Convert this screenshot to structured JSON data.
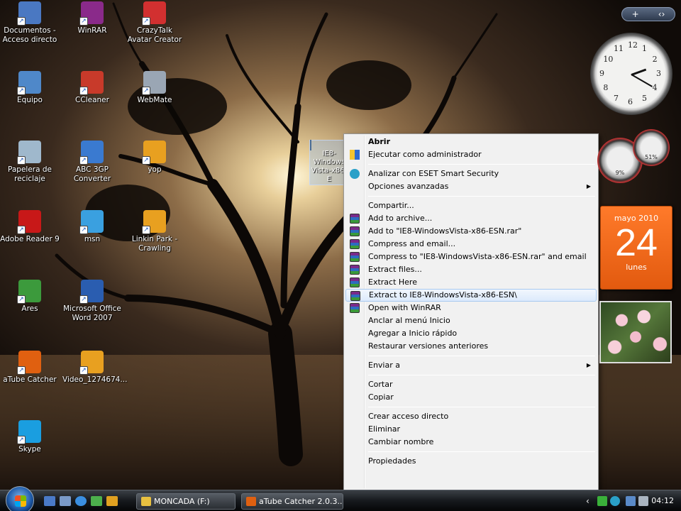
{
  "desktop_icons": [
    {
      "label": "Documentos - Acceso directo",
      "icon": "folder-shortcut-icon",
      "color": "#4a78c2"
    },
    {
      "label": "WinRAR",
      "icon": "winrar-icon",
      "color": "#8a2a8a"
    },
    {
      "label": "CrazyTalk Avatar Creator",
      "icon": "crazytalk-icon",
      "color": "#d23030"
    },
    {
      "label": "Equipo",
      "icon": "computer-icon",
      "color": "#4f88c9"
    },
    {
      "label": "CCleaner",
      "icon": "ccleaner-icon",
      "color": "#c83a2a"
    },
    {
      "label": "WebMate",
      "icon": "webmate-icon",
      "color": "#9aa6b4"
    },
    {
      "label": "Papelera de reciclaje",
      "icon": "recycle-bin-icon",
      "color": "#9fb8cc"
    },
    {
      "label": "ABC 3GP Converter",
      "icon": "abc-3gp-converter-icon",
      "color": "#3a7ad0"
    },
    {
      "label": "yop",
      "icon": "video-file-icon",
      "color": "#e8a020"
    },
    {
      "label": "Adobe Reader 9",
      "icon": "adobe-reader-icon",
      "color": "#c81818"
    },
    {
      "label": "msn",
      "icon": "msn-icon",
      "color": "#3aa0e0"
    },
    {
      "label": "Linkin Park - Crawling",
      "icon": "video-file-icon",
      "color": "#e8a020"
    },
    {
      "label": "Ares",
      "icon": "ares-icon",
      "color": "#3c9a3c"
    },
    {
      "label": "Microsoft Office Word 2007",
      "icon": "word-icon",
      "color": "#2a5db0"
    },
    {
      "label": "aTube Catcher",
      "icon": "atube-catcher-icon",
      "color": "#e06010"
    },
    {
      "label": "Video_1274674...",
      "icon": "video-file-icon",
      "color": "#e8a020"
    },
    {
      "label": "Skype",
      "icon": "skype-icon",
      "color": "#1a9ee0"
    }
  ],
  "selected_file": {
    "label": "IE8-Windows Vista-x86-E"
  },
  "context_menu": {
    "groups": [
      [
        {
          "label": "Abrir",
          "bold": true,
          "icon": "",
          "submenu": false
        },
        {
          "label": "Ejecutar como administrador",
          "icon": "shield-icon",
          "submenu": false
        }
      ],
      [
        {
          "label": "Analizar con ESET Smart Security",
          "icon": "eset-icon",
          "submenu": false
        },
        {
          "label": "Opciones avanzadas",
          "icon": "",
          "submenu": true
        }
      ],
      [
        {
          "label": "Compartir...",
          "icon": "",
          "submenu": false
        },
        {
          "label": "Add to archive...",
          "icon": "winrar-icon",
          "submenu": false
        },
        {
          "label": "Add to \"IE8-WindowsVista-x86-ESN.rar\"",
          "icon": "winrar-icon",
          "submenu": false
        },
        {
          "label": "Compress and email...",
          "icon": "winrar-icon",
          "submenu": false
        },
        {
          "label": "Compress to \"IE8-WindowsVista-x86-ESN.rar\" and email",
          "icon": "winrar-icon",
          "submenu": false
        },
        {
          "label": "Extract files...",
          "icon": "winrar-icon",
          "submenu": false
        },
        {
          "label": "Extract Here",
          "icon": "winrar-icon",
          "submenu": false
        },
        {
          "label": "Extract to IE8-WindowsVista-x86-ESN\\",
          "icon": "winrar-icon",
          "submenu": false,
          "highlighted": true
        },
        {
          "label": "Open with WinRAR",
          "icon": "winrar-icon",
          "submenu": false
        },
        {
          "label": "Anclar al menú Inicio",
          "icon": "",
          "submenu": false
        },
        {
          "label": "Agregar a Inicio rápido",
          "icon": "",
          "submenu": false
        },
        {
          "label": "Restaurar versiones anteriores",
          "icon": "",
          "submenu": false
        }
      ],
      [
        {
          "label": "Enviar a",
          "icon": "",
          "submenu": true
        }
      ],
      [
        {
          "label": "Cortar",
          "icon": "",
          "submenu": false
        },
        {
          "label": "Copiar",
          "icon": "",
          "submenu": false
        }
      ],
      [
        {
          "label": "Crear acceso directo",
          "icon": "",
          "submenu": false
        },
        {
          "label": "Eliminar",
          "icon": "",
          "submenu": false
        },
        {
          "label": "Cambiar nombre",
          "icon": "",
          "submenu": false
        }
      ],
      [
        {
          "label": "Propiedades",
          "icon": "",
          "submenu": false
        }
      ]
    ]
  },
  "gadgets": {
    "controls": {
      "add": "+",
      "next": "‹›"
    },
    "clock_numbers": [
      "12",
      "1",
      "2",
      "3",
      "4",
      "5",
      "6",
      "7",
      "8",
      "9",
      "10",
      "11"
    ],
    "cpu_meter": {
      "value": "9%",
      "ram": "51%"
    },
    "calendar": {
      "month": "mayo 2010",
      "day": "24",
      "weekday": "lunes"
    },
    "photo": {
      "subject": "flowers"
    }
  },
  "taskbar": {
    "windows": [
      {
        "label": "MONCADA (F:)",
        "icon": "folder-icon",
        "color": "#e8c040"
      },
      {
        "label": "aTube Catcher 2.0.3...",
        "icon": "atube-catcher-icon",
        "color": "#e06010"
      }
    ],
    "clock": "04:12",
    "accent": "#1e5aa8"
  }
}
